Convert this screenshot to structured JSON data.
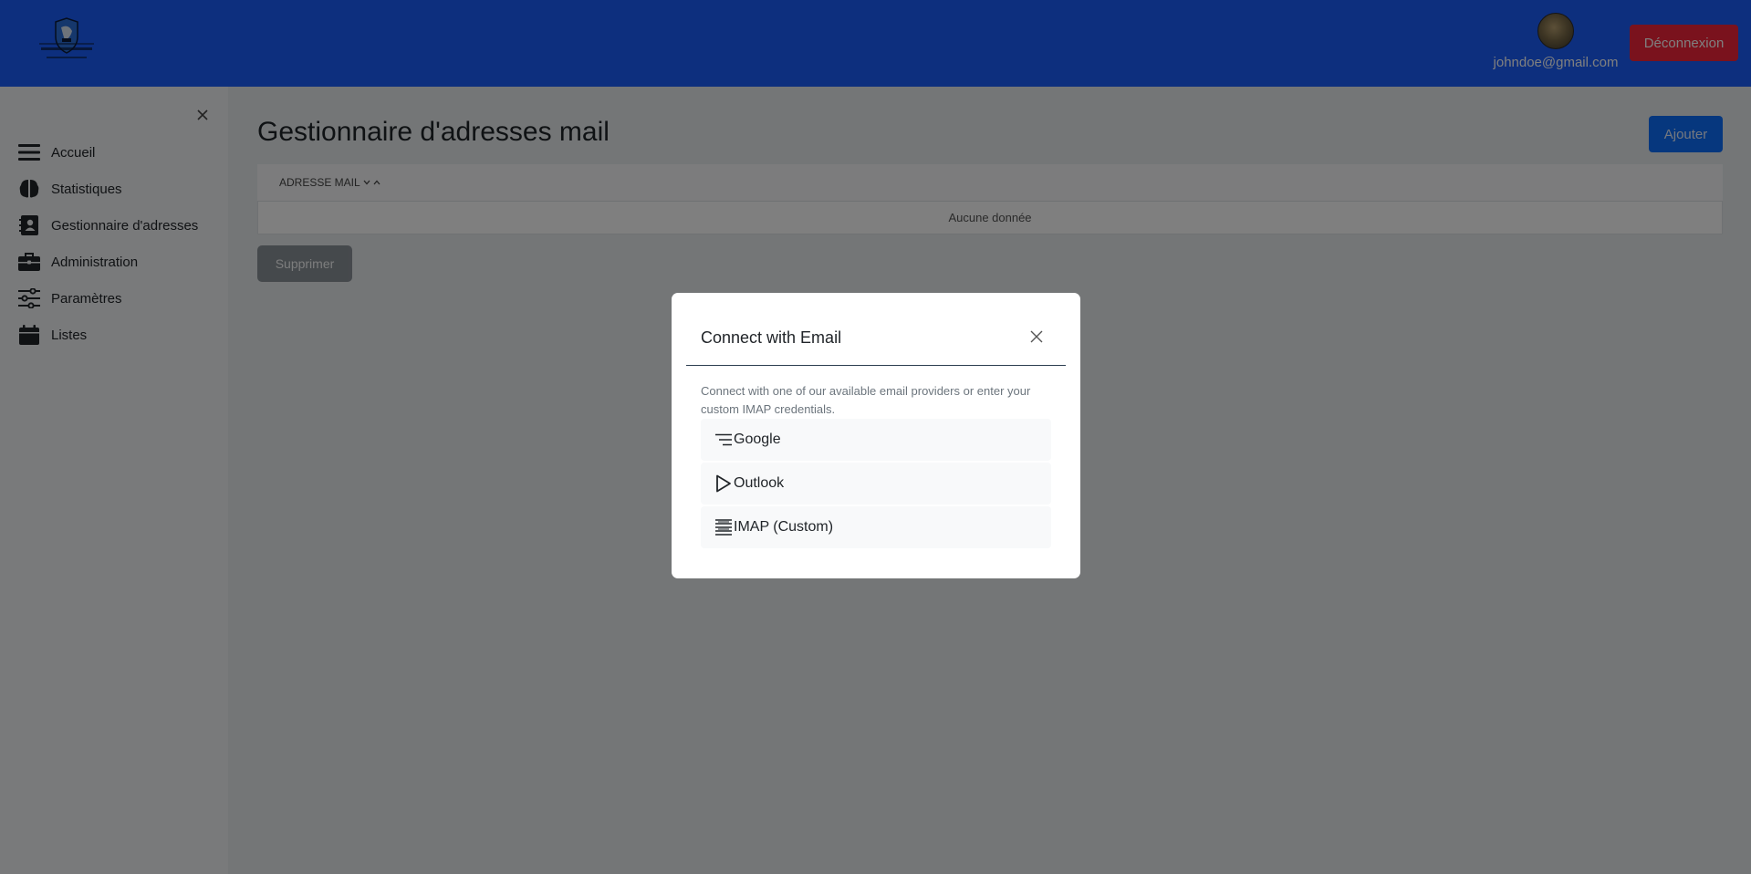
{
  "header": {
    "user_email": "johndoe@gmail.com",
    "logout_label": "Déconnexion",
    "brand_color": "#1a5ffc",
    "logout_color": "#f5243b"
  },
  "sidebar": {
    "items": [
      {
        "label": "Accueil",
        "icon": "menu-icon"
      },
      {
        "label": "Statistiques",
        "icon": "brain-icon"
      },
      {
        "label": "Gestionnaire d'adresses",
        "icon": "address-book-icon"
      },
      {
        "label": "Administration",
        "icon": "briefcase-icon"
      },
      {
        "label": "Paramètres",
        "icon": "sliders-icon"
      },
      {
        "label": "Listes",
        "icon": "calendar-icon"
      }
    ]
  },
  "main": {
    "title": "Gestionnaire d'adresses mail",
    "add_label": "Ajouter",
    "table": {
      "columns": [
        "ADRESSE MAIL"
      ],
      "empty_text": "Aucune donnée"
    },
    "delete_label": "Supprimer"
  },
  "modal": {
    "title": "Connect with Email",
    "description": "Connect with one of our available email providers or enter your custom IMAP credentials.",
    "providers": [
      {
        "label": "Google",
        "icon": "lines-icon"
      },
      {
        "label": "Outlook",
        "icon": "play-icon"
      },
      {
        "label": "IMAP (Custom)",
        "icon": "stack-icon"
      }
    ]
  }
}
